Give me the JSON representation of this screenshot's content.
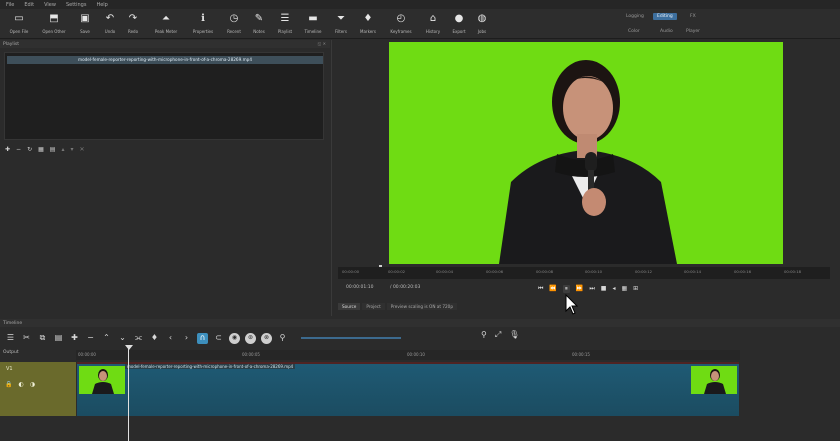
{
  "menu": [
    "File",
    "Edit",
    "View",
    "Settings",
    "Help"
  ],
  "toolbar": [
    {
      "icon": "open-file-icon",
      "glyph": "▭",
      "label": "Open File"
    },
    {
      "icon": "open-other-icon",
      "glyph": "⬒",
      "label": "Open Other"
    },
    {
      "icon": "save-icon",
      "glyph": "▣",
      "label": "Save"
    },
    {
      "icon": "undo-icon",
      "glyph": "↶",
      "label": "Undo"
    },
    {
      "icon": "redo-icon",
      "glyph": "↷",
      "label": "Redo"
    },
    {
      "icon": "peak-meter-icon",
      "glyph": "⏶",
      "label": "Peak Meter"
    },
    {
      "icon": "properties-icon",
      "glyph": "ℹ",
      "label": "Properties"
    },
    {
      "icon": "recent-icon",
      "glyph": "◷",
      "label": "Recent"
    },
    {
      "icon": "notes-icon",
      "glyph": "✎",
      "label": "Notes"
    },
    {
      "icon": "playlist-icon",
      "glyph": "☰",
      "label": "Playlist"
    },
    {
      "icon": "timeline-icon",
      "glyph": "▬",
      "label": "Timeline"
    },
    {
      "icon": "filters-icon",
      "glyph": "⏷",
      "label": "Filters"
    },
    {
      "icon": "markers-icon",
      "glyph": "♦",
      "label": "Markers"
    },
    {
      "icon": "keyframes-icon",
      "glyph": "◴",
      "label": "Keyframes"
    },
    {
      "icon": "history-icon",
      "glyph": "⌂",
      "label": "History"
    },
    {
      "icon": "export-icon",
      "glyph": "●",
      "label": "Export"
    },
    {
      "icon": "jobs-icon",
      "glyph": "◍",
      "label": "Jobs"
    }
  ],
  "layouts": {
    "logging": "Logging",
    "editing": "Editing",
    "fx": "FX",
    "color": "Color",
    "audio": "Audio",
    "player": "Player"
  },
  "playlist": {
    "header": "Playlist",
    "item": "model-female-reporter-reporting-with-microphone-in-front-of-a-chroma-28269.mp4"
  },
  "viewer": {
    "ruler_ticks": [
      "00:00:00",
      "00:00:02",
      "00:00:04",
      "00:00:06",
      "00:00:08",
      "00:00:10",
      "00:00:12",
      "00:00:14",
      "00:00:16",
      "00:00:18"
    ],
    "timecode": "00:00:01:10",
    "duration": "/ 00:00:20:03",
    "tabs": [
      "Source",
      "Project"
    ],
    "status": "Preview scaling is ON at 720p"
  },
  "timeline": {
    "header": "Timeline",
    "output_label": "Output",
    "track_name": "V1",
    "ruler_ticks": [
      "00:00:00",
      "00:00:05",
      "00:00:10",
      "00:00:15"
    ],
    "clip_title": "model-female-reporter-reporting-with-microphone-in-front-of-a-chroma-28269.mp4"
  }
}
